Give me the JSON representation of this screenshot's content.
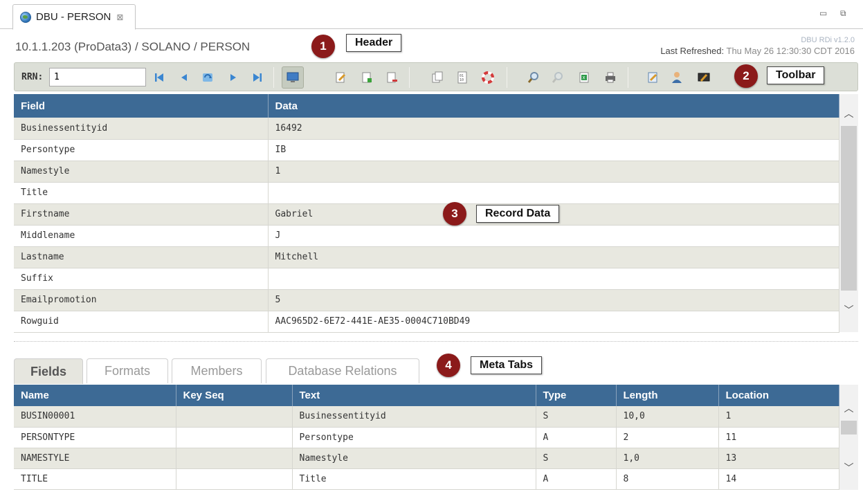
{
  "tab": {
    "title": "DBU - PERSON",
    "close_glyph": "⊠"
  },
  "header": {
    "path": "10.1.1.203 (ProData3) / SOLANO / PERSON",
    "version": "DBU RDi v1.2.0",
    "refresh_label": "Last Refreshed:",
    "refresh_value": "Thu May 26 12:30:30 CDT 2016"
  },
  "callouts": [
    {
      "num": "1",
      "label": "Header"
    },
    {
      "num": "2",
      "label": "Toolbar"
    },
    {
      "num": "3",
      "label": "Record Data"
    },
    {
      "num": "4",
      "label": "Meta Tabs"
    }
  ],
  "toolbar": {
    "rrn_label": "RRN:",
    "rrn_value": "1",
    "buttons": [
      "first-record-icon",
      "previous-record-icon",
      "refresh-icon",
      "next-record-icon",
      "last-record-icon",
      "display-icon",
      "edit-icon",
      "add-record-icon",
      "delete-record-icon",
      "copy-icon",
      "hex-icon",
      "lifebuoy-icon",
      "find-icon",
      "find-next-icon",
      "export-icon",
      "print-icon",
      "notes-icon",
      "user-icon",
      "settings-icon"
    ]
  },
  "record": {
    "columns": [
      "Field",
      "Data"
    ],
    "rows": [
      [
        "Businessentityid",
        "16492"
      ],
      [
        "Persontype",
        "IB"
      ],
      [
        "Namestyle",
        "1"
      ],
      [
        "Title",
        ""
      ],
      [
        "Firstname",
        "Gabriel"
      ],
      [
        "Middlename",
        "J"
      ],
      [
        "Lastname",
        "Mitchell"
      ],
      [
        "Suffix",
        ""
      ],
      [
        "Emailpromotion",
        "5"
      ],
      [
        "Rowguid",
        "AAC965D2-6E72-441E-AE35-0004C710BD49"
      ]
    ]
  },
  "meta_tabs": [
    "Fields",
    "Formats",
    "Members",
    "Database Relations"
  ],
  "fields": {
    "columns": [
      "Name",
      "Key Seq",
      "Text",
      "Type",
      "Length",
      "Location"
    ],
    "rows": [
      [
        "BUSIN00001",
        "",
        "Businessentityid",
        "S",
        "10,0",
        "1"
      ],
      [
        "PERSONTYPE",
        "",
        "Persontype",
        "A",
        "2",
        "11"
      ],
      [
        "NAMESTYLE",
        "",
        "Namestyle",
        "S",
        "1,0",
        "13"
      ],
      [
        "TITLE",
        "",
        "Title",
        "A",
        "8",
        "14"
      ]
    ]
  },
  "colors": {
    "header_blue": "#3d6a95",
    "badge_red": "#8b1a1a",
    "toolbar_bg": "#dcdfd7"
  }
}
